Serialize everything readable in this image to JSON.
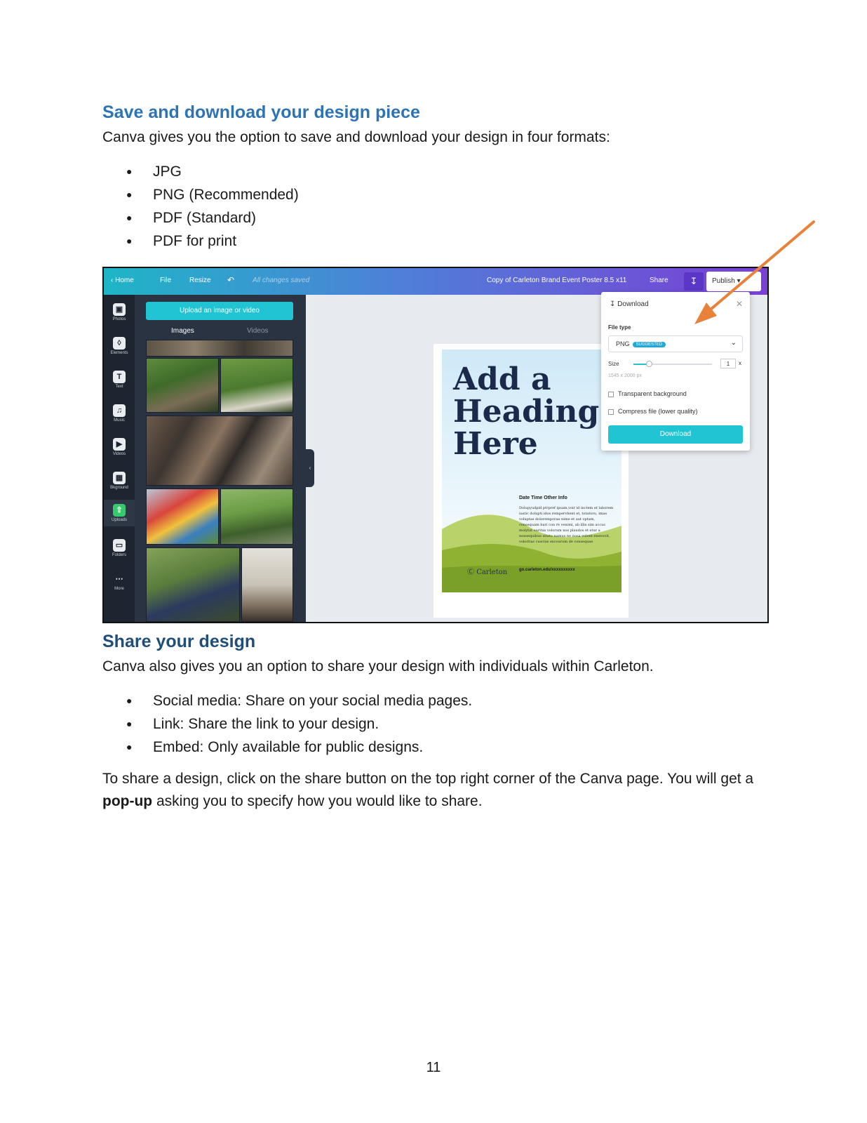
{
  "section1": {
    "heading": "Save and download your design piece",
    "intro": "Canva gives you the option to save and download your design in four formats:",
    "formats": [
      "JPG",
      "PNG (Recommended)",
      "PDF (Standard)",
      "PDF for print"
    ]
  },
  "screenshot": {
    "topbar": {
      "home": "Home",
      "file": "File",
      "resize": "Resize",
      "saved_status": "All changes saved",
      "design_title": "Copy of Carleton Brand Event Poster 8.5 x11",
      "share": "Share",
      "publish": "Publish"
    },
    "rail": [
      "Photos",
      "Elements",
      "Text",
      "Music",
      "Videos",
      "Bkground",
      "Uploads",
      "Folders",
      "More"
    ],
    "rail_icons": [
      "photo-icon",
      "shapes-icon",
      "text-icon",
      "music-icon",
      "video-icon",
      "background-icon",
      "upload-icon",
      "folder-icon",
      "more-icon"
    ],
    "upload_button": "Upload an image or video",
    "panel_tabs": [
      "Images",
      "Videos"
    ],
    "poster": {
      "heading_lines": [
        "Add a",
        "Heading",
        "Here"
      ],
      "info_title": "Date Time Other Info",
      "body": "Dolupyudpid ptrpref ipsam,voir id inctem et laborem iustic dolupti idos rempervhent et, totatoru, imas voluptas doloremporae nime et aut optam, consequam bari con re venimi, ab illis sim accus molytat earitas volorum nos plaudos et etur a nonsequibus sitatu namus ne nusa volent enevovit, voloritas cuscius excourum de consequae",
      "brand": "Carleton",
      "url": "go.carleton.edu/xxxxxxxxxx"
    },
    "download_panel": {
      "title": "Download",
      "file_type_label": "File type",
      "file_type_value": "PNG",
      "suggested_badge": "SUGGESTED",
      "size_label": "Size",
      "size_value": "1",
      "size_unit": "x",
      "dimensions": "1545 x 2000 px",
      "transparent": "Transparent background",
      "compress": "Compress file (lower quality)",
      "button": "Download"
    },
    "accent": "#21c4d2",
    "arrow_color": "#e8823a"
  },
  "section2": {
    "heading": "Share your design",
    "intro": "Canva also gives you an option to share your design with individuals within Carleton.",
    "options": [
      "Social media: Share on your social media pages.",
      "Link: Share the link to your design.",
      "Embed: Only available for public designs."
    ],
    "para_before": "To share a design, click on the share button on the top right corner of the Canva page. You will get a ",
    "para_bold": "pop-up",
    "para_after": " asking you to specify how you would like to share."
  },
  "page_number": "11"
}
